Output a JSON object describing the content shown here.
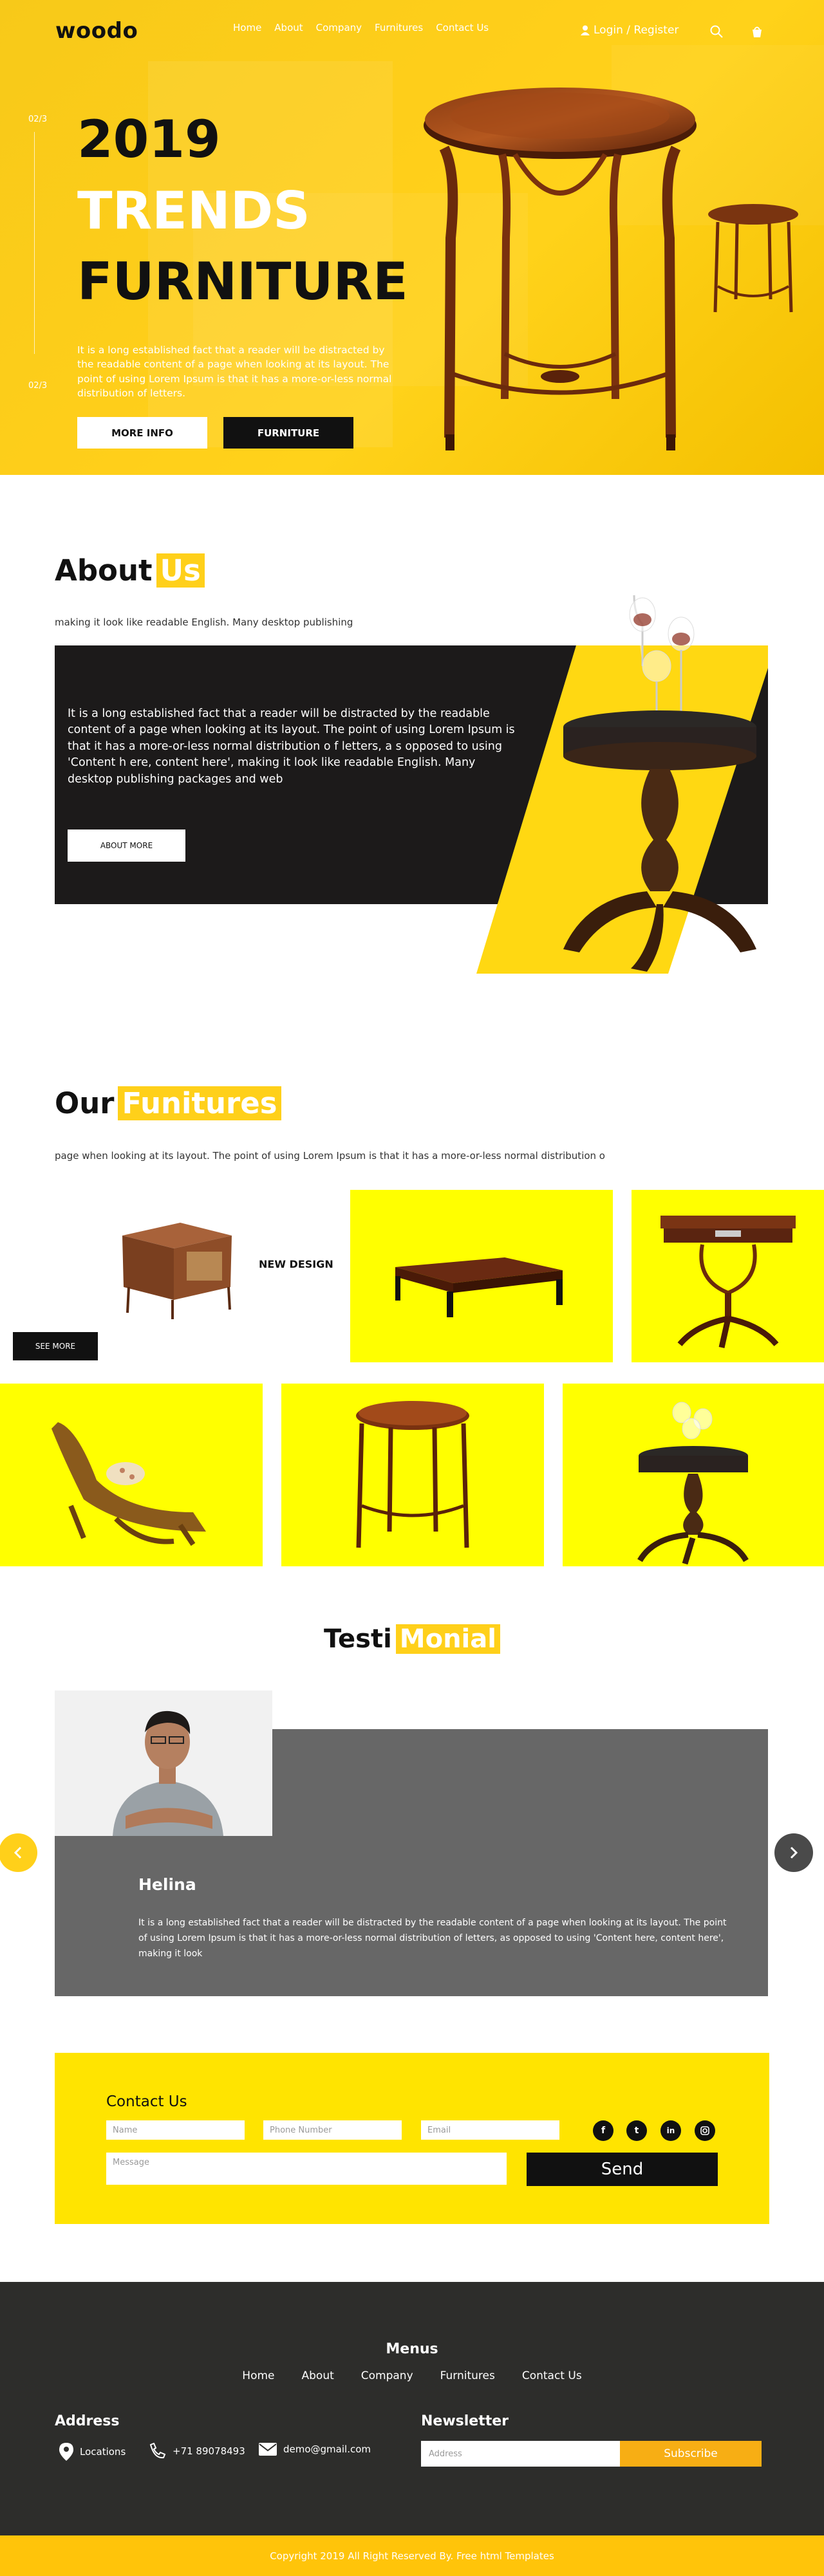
{
  "header": {
    "logo": "woodo",
    "nav": [
      "Home",
      "About",
      "Company",
      "Furnitures",
      "Contact Us"
    ],
    "login": "Login / Register"
  },
  "hero": {
    "slide_top": "02/3",
    "slide_bottom": "02/3",
    "line1": "2019",
    "line2": "TRENDS",
    "line3": "FURNITURE",
    "text": "It is a long established fact that a reader will be distracted by the readable content of a page when looking at its layout. The point of using Lorem Ipsum is that it has a more-or-less normal distribution of letters.",
    "btn_more": "MORE INFO",
    "btn_furniture": "FURNITURE"
  },
  "about": {
    "title_a": "About",
    "title_b": "Us",
    "subtitle": "making it look like readable English. Many desktop publishing",
    "text": "It is a long established fact that a reader will be distracted by the readable content of a page when looking at its layout. The point of using Lorem Ipsum is that it has a more-or-less normal distribution o f letters, a s opposed to using 'Content h ere, content here', making it look like readable English. Many desktop publishing packages and web",
    "button": "ABOUT MORE"
  },
  "furnitures": {
    "title_a": "Our",
    "title_b": "Funitures",
    "subtitle": "page when looking at its layout. The point of using Lorem Ipsum is that it has a more-or-less normal distribution o",
    "new_design": "NEW DESIGN",
    "see_more": "SEE MORE"
  },
  "testimonial": {
    "title_a": "Testi",
    "title_b": "Monial",
    "name": "Helina",
    "text": "It is a long established fact that a reader will be distracted by the readable content of a page when looking at its layout. The point of using Lorem Ipsum is that it has a more-or-less normal distribution of letters, as opposed to using 'Content here, content here', making it look"
  },
  "contact": {
    "title": "Contact Us",
    "name_ph": "Name",
    "phone_ph": "Phone Number",
    "email_ph": "Email",
    "message_ph": "Message",
    "send": "Send"
  },
  "footer": {
    "menus_title": "Menus",
    "links": [
      "Home",
      "About",
      "Company",
      "Furnitures",
      "Contact Us"
    ],
    "address_title": "Address",
    "location": "Locations",
    "phone": "+71 89078493",
    "email": "demo@gmail.com",
    "newsletter_title": "Newsletter",
    "newsletter_ph": "Address",
    "subscribe": "Subscribe",
    "copyright": "Copyright 2019 All Right Reserved By. Free html Templates"
  },
  "colors": {
    "accent_yellow": "#ffd01a",
    "tile_yellow": "#ffff00",
    "dark": "#1c1a1a",
    "footer": "#2d2d2b"
  }
}
